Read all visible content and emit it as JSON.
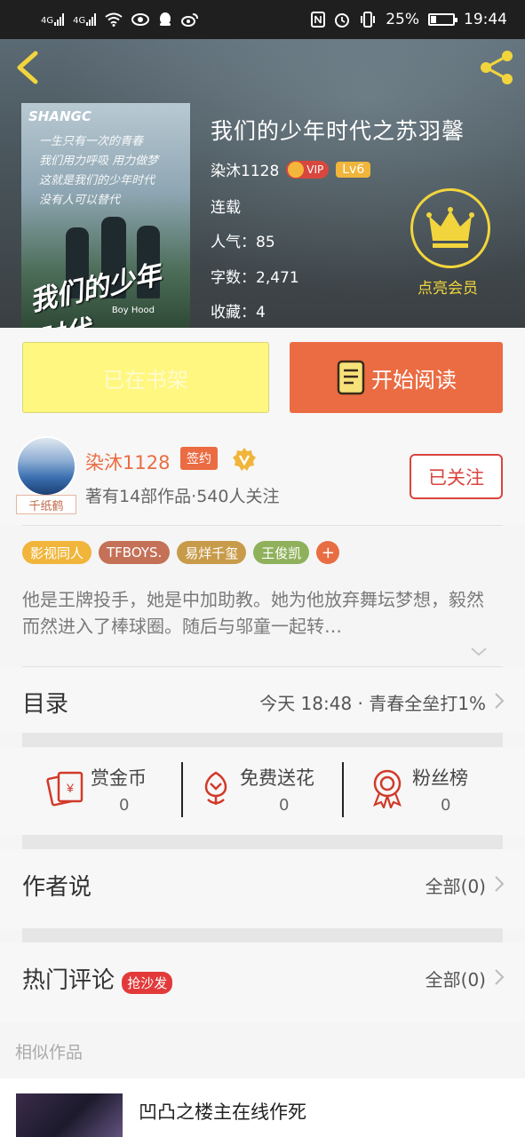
{
  "status_bar": {
    "net1": "4G",
    "net2": "4G",
    "battery": "25%",
    "time": "19:44"
  },
  "book": {
    "title": "我们的少年时代之苏羽馨",
    "author": "染沐1128",
    "vip": "VIP",
    "level": "Lv6",
    "status": "连载",
    "popularity_label": "人气：",
    "popularity": "85",
    "words_label": "字数：",
    "words": "2,471",
    "favorites_label": "收藏：",
    "favorites": "4",
    "member_label": "点亮会员",
    "cover": {
      "brand": "SHANGC",
      "lines": [
        "一生只有一次的青春",
        "我们用力呼吸 用力做梦",
        "这就是我们的少年时代",
        "没有人可以替代"
      ],
      "art_title": "我们的少年时代",
      "art_sub": "Boy Hood"
    }
  },
  "actions": {
    "shelf": "已在书架",
    "read": "开始阅读"
  },
  "author_card": {
    "name": "染沐1128",
    "sign": "签约",
    "avatar_tag": "千纸鹤",
    "stats": "著有14部作品·540人关注",
    "follow": "已关注"
  },
  "tags": [
    {
      "label": "影视同人",
      "color": "#f0b53a"
    },
    {
      "label": "TFBOYS.",
      "color": "#c47158"
    },
    {
      "label": "易烊千玺",
      "color": "#c89b4a"
    },
    {
      "label": "王俊凯",
      "color": "#8fb15c"
    }
  ],
  "synopsis": "他是王牌投手，她是中加助教。她为他放弃舞坛梦想，毅然而然进入了棒球圈。随后与邬童一起转…",
  "toc": {
    "label": "目录",
    "latest": "今天 18:48 · 青春全垒打1%"
  },
  "rewards": [
    {
      "name": "赏金币",
      "value": "0"
    },
    {
      "name": "免费送花",
      "value": "0"
    },
    {
      "name": "粉丝榜",
      "value": "0"
    }
  ],
  "author_says": {
    "label": "作者说",
    "all": "全部(0)"
  },
  "hot_comments": {
    "label": "热门评论",
    "badge": "抢沙发",
    "all": "全部(0)"
  },
  "similar": {
    "title": "相似作品",
    "items": [
      {
        "title": "凹凸之楼主在线作死"
      }
    ]
  },
  "colors": {
    "accent": "#eb6c43",
    "shelf": "#fff77f",
    "gold": "#f2d53d"
  }
}
